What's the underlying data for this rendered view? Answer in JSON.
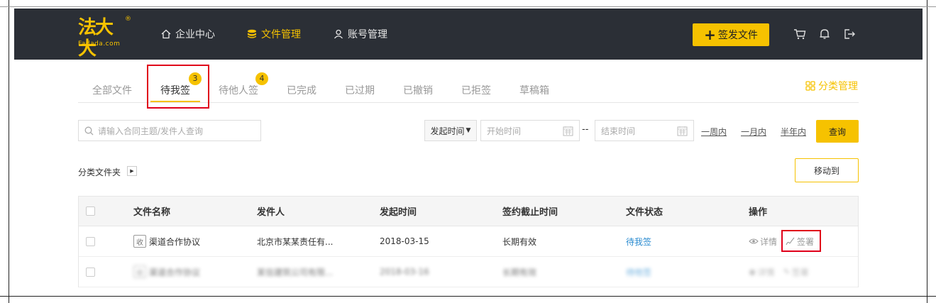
{
  "header": {
    "logo_text": "法大大",
    "logo_sub": "Fadada.com",
    "logo_reg": "®",
    "nav": [
      {
        "label": "企业中心",
        "icon": "home-icon"
      },
      {
        "label": "文件管理",
        "icon": "database-icon",
        "active": true
      },
      {
        "label": "账号管理",
        "icon": "user-icon"
      }
    ],
    "send_button": "签发文件",
    "icons": [
      "cart-icon",
      "bell-icon",
      "logout-icon"
    ]
  },
  "tabs": {
    "items": [
      {
        "label": "全部文件"
      },
      {
        "label": "待我签",
        "badge": "3",
        "active": true
      },
      {
        "label": "待他人签",
        "badge": "4"
      },
      {
        "label": "已完成"
      },
      {
        "label": "已过期"
      },
      {
        "label": "已撤销"
      },
      {
        "label": "已拒签"
      },
      {
        "label": "草稿箱"
      }
    ],
    "category_manage": "分类管理"
  },
  "filters": {
    "search_placeholder": "请输入合同主题/发件人查询",
    "time_select": "发起时间",
    "start_placeholder": "开始时间",
    "end_placeholder": "结束时间",
    "separator": "--",
    "quick": [
      "一周内",
      "一月内",
      "半年内"
    ],
    "query_button": "查询"
  },
  "folder": {
    "label": "分类文件夹",
    "move_button": "移动到"
  },
  "table": {
    "columns": [
      "文件名称",
      "发件人",
      "发起时间",
      "签约截止时间",
      "文件状态",
      "操作"
    ],
    "rows": [
      {
        "tag": "收",
        "name": "渠道合作协议",
        "sender": "北京市某某责任有...",
        "start": "2018-03-15",
        "deadline": "长期有效",
        "status": "待我签",
        "detail": "详情",
        "sign": "签署"
      },
      {
        "tag": "收",
        "name": "渠道合作协议",
        "sender": "某信建筑公司有限...",
        "start": "2018-03-16",
        "deadline": "长期有效",
        "status": "待他签",
        "detail": "详情",
        "sign": "签署"
      }
    ]
  },
  "colors": {
    "topbar": "#2b2f36",
    "accent": "#f6c200",
    "highlight": "#e0001a",
    "link": "#2a8bd0"
  }
}
